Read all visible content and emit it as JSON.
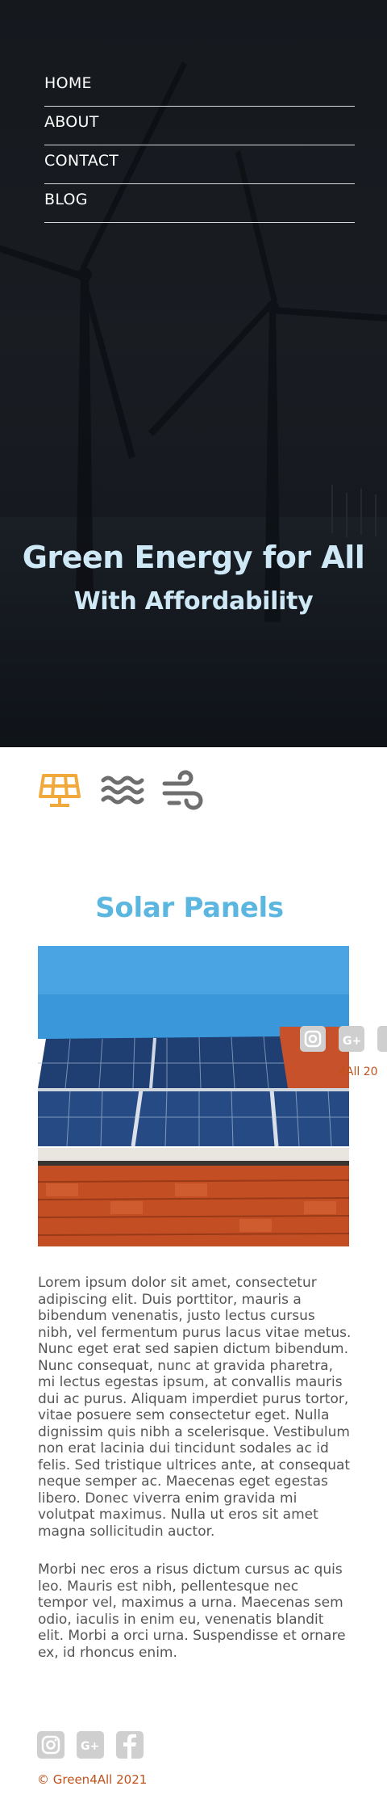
{
  "nav": {
    "items": [
      {
        "label": "HOME"
      },
      {
        "label": "ABOUT"
      },
      {
        "label": "CONTACT"
      },
      {
        "label": "BLOG"
      }
    ]
  },
  "hero": {
    "title": "Green Energy for All",
    "subtitle": "With Affordability"
  },
  "tabs": [
    {
      "icon": "solar-panel-icon",
      "active": true,
      "color": "#f0a93a"
    },
    {
      "icon": "water-waves-icon",
      "active": false,
      "color": "#6e6e6e"
    },
    {
      "icon": "wind-icon",
      "active": false,
      "color": "#6e6e6e"
    }
  ],
  "section": {
    "title": "Solar Panels",
    "paragraphs": [
      "Lorem ipsum dolor sit amet, consectetur adipiscing elit. Duis porttitor, mauris a bibendum venenatis, justo lectus cursus nibh, vel fermentum purus lacus vitae metus. Nunc eget erat sed sapien dictum bibendum. Nunc consequat, nunc at gravida pharetra, mi lectus egestas ipsum, at convallis mauris dui ac purus. Aliquam imperdiet purus tortor, vitae posuere sem consectetur eget. Nulla dignissim quis nibh a scelerisque. Vestibulum non erat lacinia dui tincidunt sodales ac id felis. Sed tristique ultrices ante, at consequat neque semper ac. Maecenas eget egestas libero. Donec viverra enim gravida mi volutpat maximus. Nulla ut eros sit amet magna sollicitudin auctor.",
      "Morbi nec eros a risus dictum cursus ac quis leo. Mauris est nibh, pellentesque nec tempor vel, maximus a urna. Maecenas sem odio, iaculis in enim eu, venenatis blandit elit. Morbi a orci urna. Suspendisse et ornare ex, id rhoncus enim."
    ]
  },
  "stray_copyright_fragment": "4All 20",
  "footer": {
    "icons": [
      "instagram-icon",
      "google-plus-icon",
      "facebook-icon"
    ],
    "copyright": "© Green4All 2021"
  },
  "colors": {
    "accent_orange": "#f0a93a",
    "title_blue": "#5bb7e0",
    "hero_text": "#cfe8f6",
    "copyright": "#c0521b",
    "icon_gray": "#6e6e6e"
  }
}
